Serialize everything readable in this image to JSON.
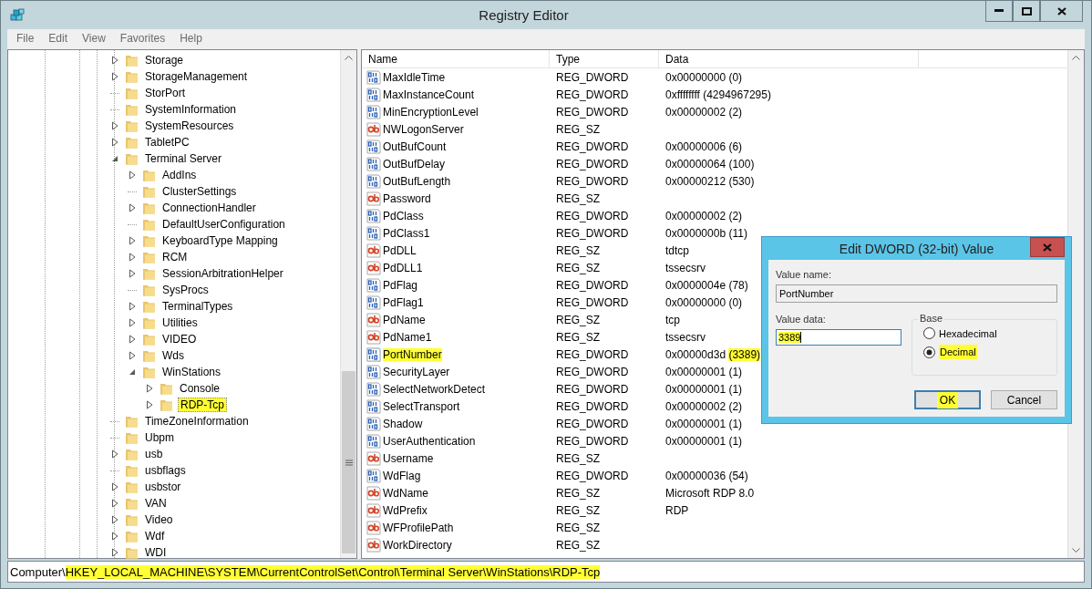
{
  "window": {
    "title": "Registry Editor"
  },
  "menu": [
    "File",
    "Edit",
    "View",
    "Favorites",
    "Help"
  ],
  "tree": {
    "items": [
      {
        "label": "Storage",
        "expanded": false,
        "selected": false,
        "highlighted": false
      },
      {
        "label": "StorageManagement",
        "expanded": false,
        "selected": false,
        "highlighted": false
      },
      {
        "label": "StorPort",
        "selected": false,
        "highlighted": false
      },
      {
        "label": "SystemInformation",
        "selected": false,
        "highlighted": false
      },
      {
        "label": "SystemResources",
        "expanded": false,
        "selected": false,
        "highlighted": false
      },
      {
        "label": "TabletPC",
        "expanded": false,
        "selected": false,
        "highlighted": false
      },
      {
        "label": "Terminal Server",
        "expanded": true,
        "selected": false,
        "highlighted": false,
        "children": [
          {
            "label": "AddIns",
            "expanded": false,
            "selected": false,
            "highlighted": false
          },
          {
            "label": "ClusterSettings",
            "selected": false,
            "highlighted": false
          },
          {
            "label": "ConnectionHandler",
            "expanded": false,
            "selected": false,
            "highlighted": false
          },
          {
            "label": "DefaultUserConfiguration",
            "selected": false,
            "highlighted": false
          },
          {
            "label": "KeyboardType Mapping",
            "expanded": false,
            "selected": false,
            "highlighted": false
          },
          {
            "label": "RCM",
            "expanded": false,
            "selected": false,
            "highlighted": false
          },
          {
            "label": "SessionArbitrationHelper",
            "expanded": false,
            "selected": false,
            "highlighted": false
          },
          {
            "label": "SysProcs",
            "selected": false,
            "highlighted": false
          },
          {
            "label": "TerminalTypes",
            "expanded": false,
            "selected": false,
            "highlighted": false
          },
          {
            "label": "Utilities",
            "expanded": false,
            "selected": false,
            "highlighted": false
          },
          {
            "label": "VIDEO",
            "expanded": false,
            "selected": false,
            "highlighted": false
          },
          {
            "label": "Wds",
            "expanded": false,
            "selected": false,
            "highlighted": false
          },
          {
            "label": "WinStations",
            "expanded": true,
            "selected": false,
            "highlighted": false,
            "children": [
              {
                "label": "Console",
                "expanded": false,
                "selected": false,
                "highlighted": false
              },
              {
                "label": "RDP-Tcp",
                "expanded": false,
                "selected": true,
                "highlighted": true
              }
            ]
          }
        ]
      },
      {
        "label": "TimeZoneInformation",
        "selected": false,
        "highlighted": false
      },
      {
        "label": "Ubpm",
        "selected": false,
        "highlighted": false
      },
      {
        "label": "usb",
        "expanded": false,
        "selected": false,
        "highlighted": false
      },
      {
        "label": "usbflags",
        "selected": false,
        "highlighted": false
      },
      {
        "label": "usbstor",
        "expanded": false,
        "selected": false,
        "highlighted": false
      },
      {
        "label": "VAN",
        "expanded": false,
        "selected": false,
        "highlighted": false
      },
      {
        "label": "Video",
        "expanded": false,
        "selected": false,
        "highlighted": false
      },
      {
        "label": "Wdf",
        "expanded": false,
        "selected": false,
        "highlighted": false
      },
      {
        "label": "WDI",
        "expanded": false,
        "selected": false,
        "highlighted": false
      }
    ]
  },
  "table": {
    "columns": [
      "Name",
      "Type",
      "Data"
    ],
    "rows": [
      {
        "name": "MaxIdleTime",
        "kind": "dword",
        "type": "REG_DWORD",
        "data": "0x00000000",
        "decimal": "(0)",
        "selected": false,
        "highlighted": false
      },
      {
        "name": "MaxInstanceCount",
        "kind": "dword",
        "type": "REG_DWORD",
        "data": "0xffffffff",
        "decimal": "(4294967295)",
        "selected": false,
        "highlighted": false
      },
      {
        "name": "MinEncryptionLevel",
        "kind": "dword",
        "type": "REG_DWORD",
        "data": "0x00000002",
        "decimal": "(2)",
        "selected": false,
        "highlighted": false
      },
      {
        "name": "NWLogonServer",
        "kind": "string",
        "type": "REG_SZ",
        "selected": false,
        "highlighted": false
      },
      {
        "name": "OutBufCount",
        "kind": "dword",
        "type": "REG_DWORD",
        "data": "0x00000006",
        "decimal": "(6)",
        "selected": false,
        "highlighted": false
      },
      {
        "name": "OutBufDelay",
        "kind": "dword",
        "type": "REG_DWORD",
        "data": "0x00000064",
        "decimal": "(100)",
        "selected": false,
        "highlighted": false
      },
      {
        "name": "OutBufLength",
        "kind": "dword",
        "type": "REG_DWORD",
        "data": "0x00000212",
        "decimal": "(530)",
        "selected": false,
        "highlighted": false
      },
      {
        "name": "Password",
        "kind": "string",
        "type": "REG_SZ",
        "selected": false,
        "highlighted": false
      },
      {
        "name": "PdClass",
        "kind": "dword",
        "type": "REG_DWORD",
        "data": "0x00000002",
        "decimal": "(2)",
        "selected": false,
        "highlighted": false
      },
      {
        "name": "PdClass1",
        "kind": "dword",
        "type": "REG_DWORD",
        "data": "0x0000000b",
        "decimal": "(11)",
        "selected": false,
        "highlighted": false
      },
      {
        "name": "PdDLL",
        "kind": "string",
        "type": "REG_SZ",
        "data": "tdtcp",
        "selected": false,
        "highlighted": false
      },
      {
        "name": "PdDLL1",
        "kind": "string",
        "type": "REG_SZ",
        "data": "tssecsrv",
        "selected": false,
        "highlighted": false
      },
      {
        "name": "PdFlag",
        "kind": "dword",
        "type": "REG_DWORD",
        "data": "0x0000004e",
        "decimal": "(78)",
        "selected": false,
        "highlighted": false
      },
      {
        "name": "PdFlag1",
        "kind": "dword",
        "type": "REG_DWORD",
        "data": "0x00000000",
        "decimal": "(0)",
        "selected": false,
        "highlighted": false
      },
      {
        "name": "PdName",
        "kind": "string",
        "type": "REG_SZ",
        "data": "tcp",
        "selected": false,
        "highlighted": false
      },
      {
        "name": "PdName1",
        "kind": "string",
        "type": "REG_SZ",
        "data": "tssecsrv",
        "selected": false,
        "highlighted": false
      },
      {
        "name": "PortNumber",
        "kind": "dword",
        "type": "REG_DWORD",
        "data": "0x00000d3d",
        "decimal": "(3389)",
        "selected": true,
        "highlighted": true
      },
      {
        "name": "SecurityLayer",
        "kind": "dword",
        "type": "REG_DWORD",
        "data": "0x00000001",
        "decimal": "(1)",
        "selected": false,
        "highlighted": false
      },
      {
        "name": "SelectNetworkDetect",
        "kind": "dword",
        "type": "REG_DWORD",
        "data": "0x00000001",
        "decimal": "(1)",
        "selected": false,
        "highlighted": false
      },
      {
        "name": "SelectTransport",
        "kind": "dword",
        "type": "REG_DWORD",
        "data": "0x00000002",
        "decimal": "(2)",
        "selected": false,
        "highlighted": false
      },
      {
        "name": "Shadow",
        "kind": "dword",
        "type": "REG_DWORD",
        "data": "0x00000001",
        "decimal": "(1)",
        "selected": false,
        "highlighted": false
      },
      {
        "name": "UserAuthentication",
        "kind": "dword",
        "type": "REG_DWORD",
        "data": "0x00000001",
        "decimal": "(1)",
        "selected": false,
        "highlighted": false
      },
      {
        "name": "Username",
        "kind": "string",
        "type": "REG_SZ",
        "selected": false,
        "highlighted": false
      },
      {
        "name": "WdFlag",
        "kind": "dword",
        "type": "REG_DWORD",
        "data": "0x00000036",
        "decimal": "(54)",
        "selected": false,
        "highlighted": false
      },
      {
        "name": "WdName",
        "kind": "string",
        "type": "REG_SZ",
        "data": "Microsoft RDP 8.0",
        "selected": false,
        "highlighted": false
      },
      {
        "name": "WdPrefix",
        "kind": "string",
        "type": "REG_SZ",
        "data": "RDP",
        "selected": false,
        "highlighted": false
      },
      {
        "name": "WFProfilePath",
        "kind": "string",
        "type": "REG_SZ",
        "selected": false,
        "highlighted": false
      },
      {
        "name": "WorkDirectory",
        "kind": "string",
        "type": "REG_SZ",
        "selected": false,
        "highlighted": false
      }
    ]
  },
  "status_bar": {
    "root": "Computer\\",
    "path": "HKEY_LOCAL_MACHINE\\SYSTEM\\CurrentControlSet\\Control\\Terminal Server\\WinStations\\RDP-Tcp",
    "path_highlighted": true
  },
  "dialog": {
    "title": "Edit DWORD (32-bit) Value",
    "name_label": "Value name:",
    "name_value": "PortNumber",
    "data_label": "Value data:",
    "data_value": "3389",
    "data_highlighted": true,
    "base_label": "Base",
    "bases": [
      {
        "label": "Hexadecimal",
        "selected": false,
        "highlighted": false
      },
      {
        "label": "Decimal",
        "selected": true,
        "highlighted": true
      }
    ],
    "buttons": [
      {
        "label": "OK",
        "default": true,
        "highlighted": true
      },
      {
        "label": "Cancel",
        "default": false,
        "highlighted": false
      }
    ]
  }
}
